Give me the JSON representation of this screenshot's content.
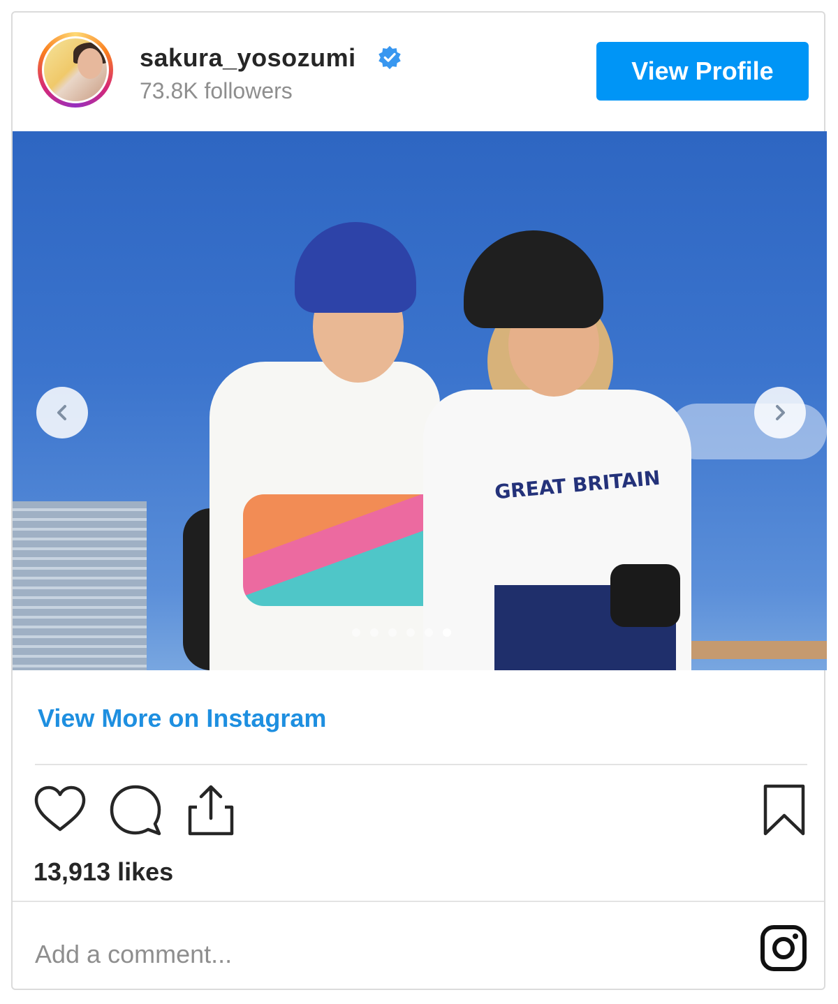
{
  "profile": {
    "username": "sakura_yosozumi",
    "followers": "73.8K followers",
    "verified_icon": "verified-badge-icon",
    "view_profile_label": "View Profile"
  },
  "media": {
    "shirt_text": "GREAT BRITAIN",
    "carousel_count": 6,
    "active_index": 5,
    "nav_prev_icon": "chevron-left-icon",
    "nav_next_icon": "chevron-right-icon"
  },
  "links": {
    "view_more": "View More on Instagram"
  },
  "actions": {
    "like_icon": "heart-icon",
    "comment_icon": "comment-bubble-icon",
    "share_icon": "share-icon",
    "save_icon": "bookmark-icon",
    "likes": "13,913 likes"
  },
  "comment": {
    "placeholder": "Add a comment...",
    "logo_icon": "instagram-logo-icon"
  },
  "colors": {
    "accent": "#0095f6",
    "link": "#1e8fe0",
    "sky": "#3b74cd"
  }
}
